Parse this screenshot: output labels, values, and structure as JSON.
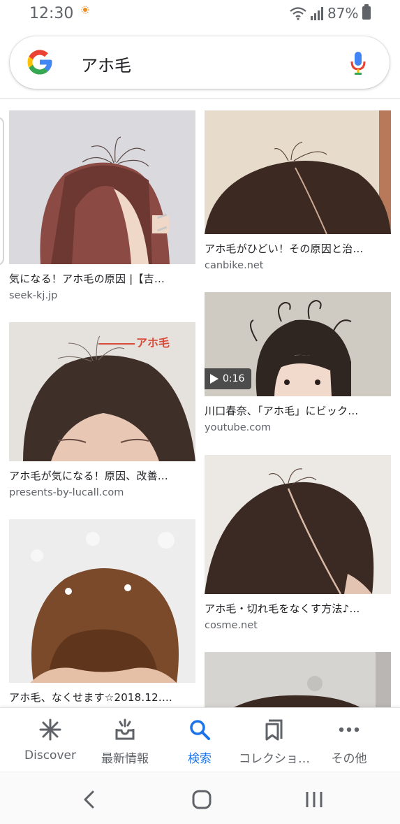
{
  "status_bar": {
    "time": "12:30",
    "battery": "87%"
  },
  "search": {
    "query": "アホ毛"
  },
  "results": [
    {
      "title": "気になる！アホ毛の原因 |【吉…",
      "source": "seek-kj.jp"
    },
    {
      "title": "アホ毛が気になる！原因、改善…",
      "source": "presents-by-lucall.com"
    },
    {
      "title": "アホ毛、なくせます☆2018.12.…",
      "source": ""
    },
    {
      "title": "アホ毛がひどい！その原因と治…",
      "source": "canbike.net"
    },
    {
      "title": "川口春奈、「アホ毛」にビック…",
      "source": "youtube.com",
      "duration": "0:16"
    },
    {
      "title": "アホ毛・切れ毛をなくす方法♪…",
      "source": "cosme.net"
    }
  ],
  "image_text": {
    "annotation": "アホ毛"
  },
  "bottom_nav": {
    "items": [
      {
        "label": "Discover"
      },
      {
        "label": "最新情報"
      },
      {
        "label": "検索"
      },
      {
        "label": "コレクショ…"
      },
      {
        "label": "その他"
      }
    ]
  },
  "colors": {
    "accent": "#1a73e8",
    "text_primary": "#202124",
    "text_secondary": "#5f6368"
  }
}
